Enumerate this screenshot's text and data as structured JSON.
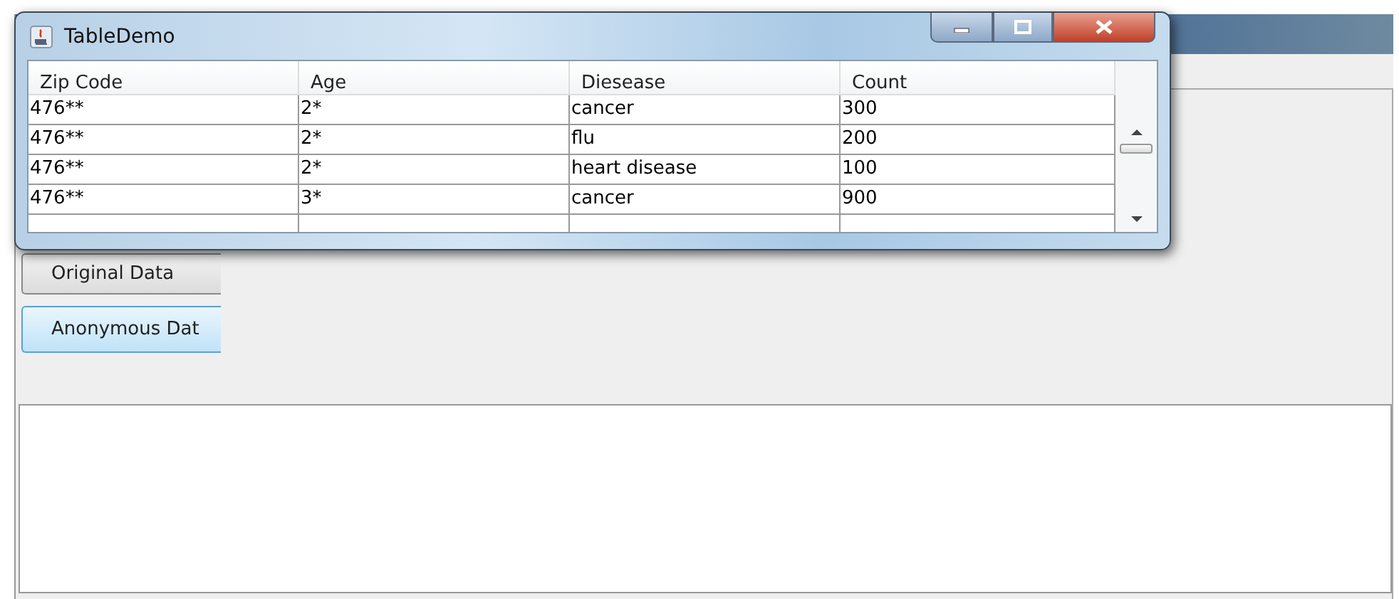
{
  "dialog": {
    "title": "TableDemo",
    "table": {
      "columns": [
        "Zip Code",
        "Age",
        "Diesease",
        "Count"
      ],
      "rows": [
        [
          "476**",
          "2*",
          "cancer",
          "300"
        ],
        [
          "476**",
          "2*",
          "flu",
          "200"
        ],
        [
          "476**",
          "2*",
          "heart disease",
          "100"
        ],
        [
          "476**",
          "3*",
          "cancer",
          "900"
        ]
      ]
    }
  },
  "buttons": [
    {
      "label": "Original Data",
      "selected": false
    },
    {
      "label": "Anonymous Dat",
      "selected": true
    }
  ]
}
